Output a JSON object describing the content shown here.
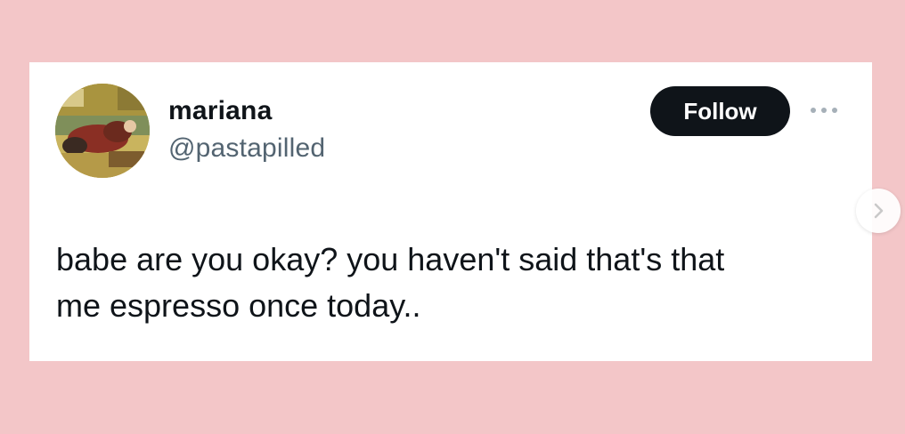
{
  "colors": {
    "page_background": "#f3c6c8",
    "card_background": "#ffffff",
    "primary_text": "#0f1419",
    "secondary_text": "#536471",
    "follow_button": "#0f1419"
  },
  "tweet": {
    "author": {
      "display_name": "mariana",
      "handle": "@pastapilled",
      "avatar_icon": "avatar-photo"
    },
    "follow_label": "Follow",
    "more_icon": "more-horizontal-icon",
    "text": "babe are you okay? you haven't said that's that\nme espresso once today.."
  },
  "carousel": {
    "next_icon": "chevron-right-icon"
  }
}
